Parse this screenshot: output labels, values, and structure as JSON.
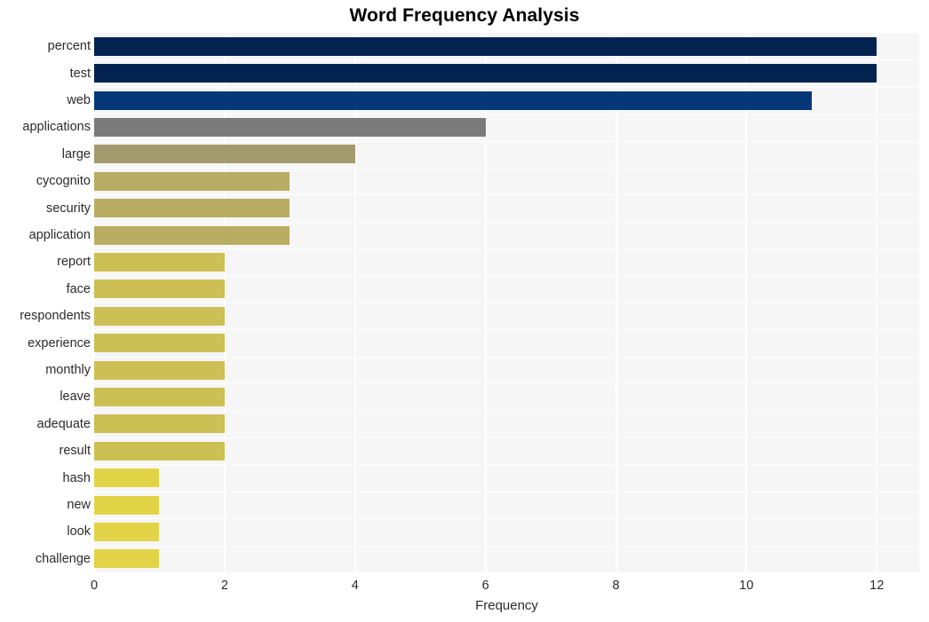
{
  "chart_data": {
    "type": "bar",
    "orientation": "horizontal",
    "title": "Word Frequency Analysis",
    "xlabel": "Frequency",
    "ylabel": "",
    "xlim": [
      0,
      12.65
    ],
    "xticks": [
      0,
      2,
      4,
      6,
      8,
      10,
      12
    ],
    "xtick_labels": [
      "0",
      "2",
      "4",
      "6",
      "8",
      "10",
      "12"
    ],
    "grid": "vertical-white-on-light-gray",
    "legend": "none",
    "categories": [
      "percent",
      "test",
      "web",
      "applications",
      "large",
      "cycognito",
      "security",
      "application",
      "report",
      "face",
      "respondents",
      "experience",
      "monthly",
      "leave",
      "adequate",
      "result",
      "hash",
      "new",
      "look",
      "challenge"
    ],
    "values": [
      12,
      12,
      11,
      6,
      4,
      3,
      3,
      3,
      2,
      2,
      2,
      2,
      2,
      2,
      2,
      2,
      1,
      1,
      1,
      1
    ],
    "bar_colors": [
      "#022350",
      "#022350",
      "#053879",
      "#7b7b7b",
      "#a39a6d",
      "#b9ac63",
      "#b9ac63",
      "#b9ac63",
      "#ccc055",
      "#ccc055",
      "#ccc055",
      "#ccc055",
      "#ccc055",
      "#ccc055",
      "#ccc055",
      "#ccc055",
      "#e3d447",
      "#e3d447",
      "#e3d447",
      "#e3d447"
    ],
    "plot_background": "#f6f6f6",
    "figure_background": "#ffffff",
    "text_color": "#2b2b2b",
    "title_color": "#000000"
  }
}
